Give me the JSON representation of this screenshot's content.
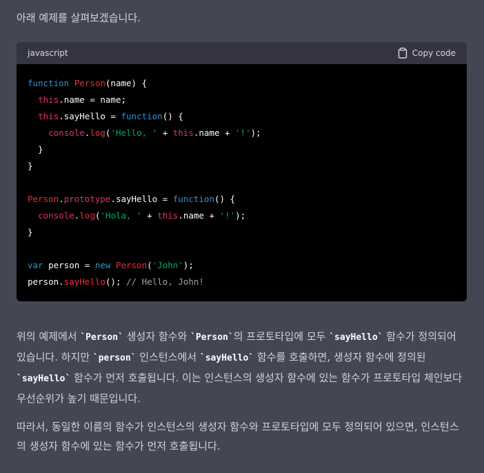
{
  "intro": "아래 예제를 살펴보겠습니다.",
  "code_block": {
    "language": "javascript",
    "copy_label": "Copy code",
    "lines": [
      [
        {
          "t": "function",
          "c": "kw"
        },
        {
          "t": " "
        },
        {
          "t": "Person",
          "c": "cls"
        },
        {
          "t": "(name) {"
        }
      ],
      [
        {
          "t": "  "
        },
        {
          "t": "this",
          "c": "this"
        },
        {
          "t": ".name = name;"
        }
      ],
      [
        {
          "t": "  "
        },
        {
          "t": "this",
          "c": "this"
        },
        {
          "t": ".sayHello = "
        },
        {
          "t": "function",
          "c": "kw"
        },
        {
          "t": "() {"
        }
      ],
      [
        {
          "t": "    "
        },
        {
          "t": "console",
          "c": "this"
        },
        {
          "t": "."
        },
        {
          "t": "log",
          "c": "fn"
        },
        {
          "t": "("
        },
        {
          "t": "'Hello, '",
          "c": "str"
        },
        {
          "t": " + "
        },
        {
          "t": "this",
          "c": "this"
        },
        {
          "t": ".name + "
        },
        {
          "t": "'!'",
          "c": "str"
        },
        {
          "t": ");"
        }
      ],
      [
        {
          "t": "  }"
        }
      ],
      [
        {
          "t": "}"
        }
      ],
      [
        {
          "t": ""
        }
      ],
      [
        {
          "t": "Person",
          "c": "cls"
        },
        {
          "t": "."
        },
        {
          "t": "prototype",
          "c": "this"
        },
        {
          "t": ".sayHello = "
        },
        {
          "t": "function",
          "c": "kw"
        },
        {
          "t": "() {"
        }
      ],
      [
        {
          "t": "  "
        },
        {
          "t": "console",
          "c": "this"
        },
        {
          "t": "."
        },
        {
          "t": "log",
          "c": "fn"
        },
        {
          "t": "("
        },
        {
          "t": "'Hola, '",
          "c": "str"
        },
        {
          "t": " + "
        },
        {
          "t": "this",
          "c": "this"
        },
        {
          "t": ".name + "
        },
        {
          "t": "'!'",
          "c": "str"
        },
        {
          "t": ");"
        }
      ],
      [
        {
          "t": "}"
        }
      ],
      [
        {
          "t": ""
        }
      ],
      [
        {
          "t": "var",
          "c": "kw"
        },
        {
          "t": " person = "
        },
        {
          "t": "new",
          "c": "kw"
        },
        {
          "t": " "
        },
        {
          "t": "Person",
          "c": "cls"
        },
        {
          "t": "("
        },
        {
          "t": "'John'",
          "c": "str"
        },
        {
          "t": ");"
        }
      ],
      [
        {
          "t": "person."
        },
        {
          "t": "sayHello",
          "c": "fn"
        },
        {
          "t": "(); "
        },
        {
          "t": "// Hello, John!",
          "c": "com"
        }
      ]
    ]
  },
  "paragraphs": [
    [
      {
        "t": "위의 예제에서 "
      },
      {
        "t": "`Person`",
        "code": true
      },
      {
        "t": " 생성자 함수와 "
      },
      {
        "t": "`Person`",
        "code": true
      },
      {
        "t": "의 프로토타입에 모두 "
      },
      {
        "t": "`sayHello`",
        "code": true
      },
      {
        "t": " 함수가 정의되어 있습니다. 하지만 "
      },
      {
        "t": "`person`",
        "code": true
      },
      {
        "t": " 인스턴스에서 "
      },
      {
        "t": "`sayHello`",
        "code": true
      },
      {
        "t": " 함수를 호출하면, 생성자 함수에 정의된 "
      },
      {
        "t": "`sayHello`",
        "code": true
      },
      {
        "t": " 함수가 먼저 호출됩니다. 이는 인스턴스의 생성자 함수에 있는 함수가 프로토타입 체인보다 우선순위가 높기 때문입니다."
      }
    ],
    [
      {
        "t": "따라서, 동일한 이름의 함수가 인스턴스의 생성자 함수와 프로토타입에 모두 정의되어 있으면, 인스턴스의 생성자 함수에 있는 함수가 먼저 호출됩니다."
      }
    ]
  ]
}
